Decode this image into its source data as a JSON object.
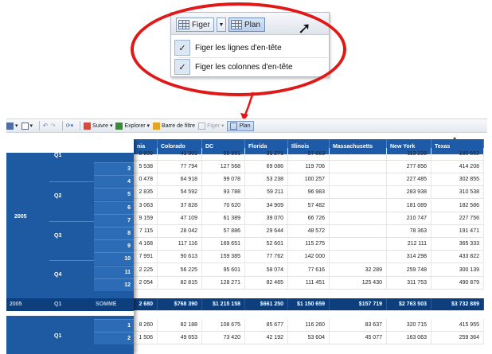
{
  "zoom": {
    "figer_label": "Figer",
    "plan_label": "Plan",
    "menu": [
      {
        "label": "Figer les lignes d'en-tête",
        "checked": true
      },
      {
        "label": "Figer les colonnes d'en-tête",
        "checked": true
      }
    ]
  },
  "toolbar": {
    "suivre": "Suivre",
    "explorer": "Explorer",
    "barre_filtre": "Barre de filtre",
    "figer": "Figer",
    "plan": "Plan"
  },
  "table": {
    "columns": [
      "nia",
      "Colorado",
      "DC",
      "Florida",
      "Illinois",
      "Massachusetts",
      "New York",
      "Texas"
    ],
    "rows": [
      [
        "8 909",
        "41 301",
        "55 951",
        "31 271",
        "57 663",
        "",
        "113 228",
        "180 662"
      ],
      [
        "5 538",
        "77 794",
        "127 568",
        "69 086",
        "119 706",
        "",
        "277 856",
        "414 208"
      ],
      [
        "0 478",
        "64 918",
        "99 078",
        "53 238",
        "100 257",
        "",
        "227 485",
        "302 855"
      ],
      [
        "2 835",
        "54 592",
        "93 788",
        "59 211",
        "96 983",
        "",
        "283 938",
        "310 538"
      ],
      [
        "3 063",
        "37 828",
        "70 620",
        "34 909",
        "57 482",
        "",
        "181 089",
        "182 586"
      ],
      [
        "9 159",
        "47 109",
        "61 389",
        "39 070",
        "66 726",
        "",
        "210 747",
        "227 756"
      ],
      [
        "7 115",
        "28 042",
        "57 886",
        "29 644",
        "48 572",
        "",
        "78 363",
        "191 471"
      ],
      [
        "4 168",
        "117 116",
        "169 651",
        "52 601",
        "115 275",
        "",
        "212 111",
        "365 333"
      ],
      [
        "7 991",
        "90 613",
        "159 385",
        "77 762",
        "142 000",
        "",
        "314 298",
        "433 822"
      ],
      [
        "2 225",
        "56 225",
        "95 601",
        "58 074",
        "77 616",
        "32 289",
        "259 748",
        "300 139"
      ],
      [
        "2 054",
        "82 815",
        "128 271",
        "82 465",
        "111 451",
        "125 430",
        "311 753",
        "490 879"
      ]
    ],
    "total": [
      "2 680",
      "$768 390",
      "$1 215 158",
      "$661 250",
      "$1 150 659",
      "$157 719",
      "$2 763 503",
      "$3 732 889"
    ],
    "after": [
      [
        "8 260",
        "82 188",
        "108 675",
        "85 677",
        "116 260",
        "83 637",
        "320 715",
        "415 955"
      ],
      [
        "1 506",
        "49 653",
        "73 420",
        "42 192",
        "53 604",
        "45 077",
        "163 063",
        "259 364"
      ]
    ]
  },
  "frozen": {
    "year": "2005",
    "quarters": [
      "Q1",
      "Q2",
      "Q3",
      "Q4"
    ],
    "months": [
      "3",
      "4",
      "5",
      "6",
      "7",
      "8",
      "9",
      "10",
      "11",
      "12"
    ],
    "total_year": "2005",
    "total_q": "Q1",
    "total_label": "SOMME",
    "after_months": [
      "1",
      "2"
    ],
    "after_q": "Q1"
  },
  "colors": {
    "header": "#1d5ba8",
    "total": "#0d3f7c",
    "highlight": "#e01818"
  }
}
